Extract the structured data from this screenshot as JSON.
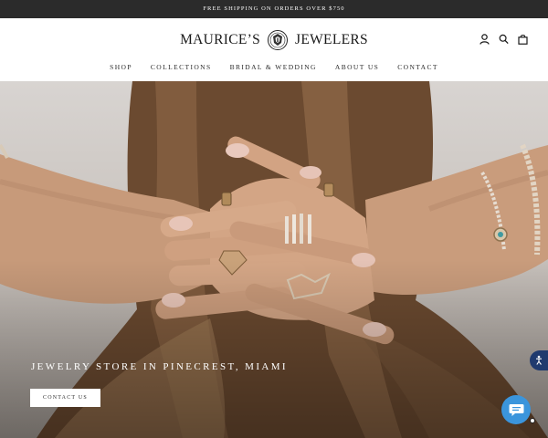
{
  "announcement": {
    "text": "FREE SHIPPING ON ORDERS OVER $750"
  },
  "brand": {
    "left": "MAURICE’S",
    "right": "JEWELERS"
  },
  "header_icons": [
    "account-icon",
    "search-icon",
    "cart-icon"
  ],
  "nav": {
    "items": [
      {
        "label": "SHOP"
      },
      {
        "label": "COLLECTIONS"
      },
      {
        "label": "BRIDAL & WEDDING"
      },
      {
        "label": "ABOUT US"
      },
      {
        "label": "CONTACT"
      }
    ]
  },
  "hero": {
    "title": "JEWELRY STORE IN PINECREST, MIAMI",
    "button_label": "CONTACT US"
  },
  "widgets": {
    "accessibility_icon": "accessibility-icon",
    "chat_icon": "chat-bubble-icon"
  },
  "colors": {
    "announcement_bg": "#2b2b2b",
    "accessibility_bg": "#1f3a6e",
    "chat_bg": "#3b95dc"
  }
}
